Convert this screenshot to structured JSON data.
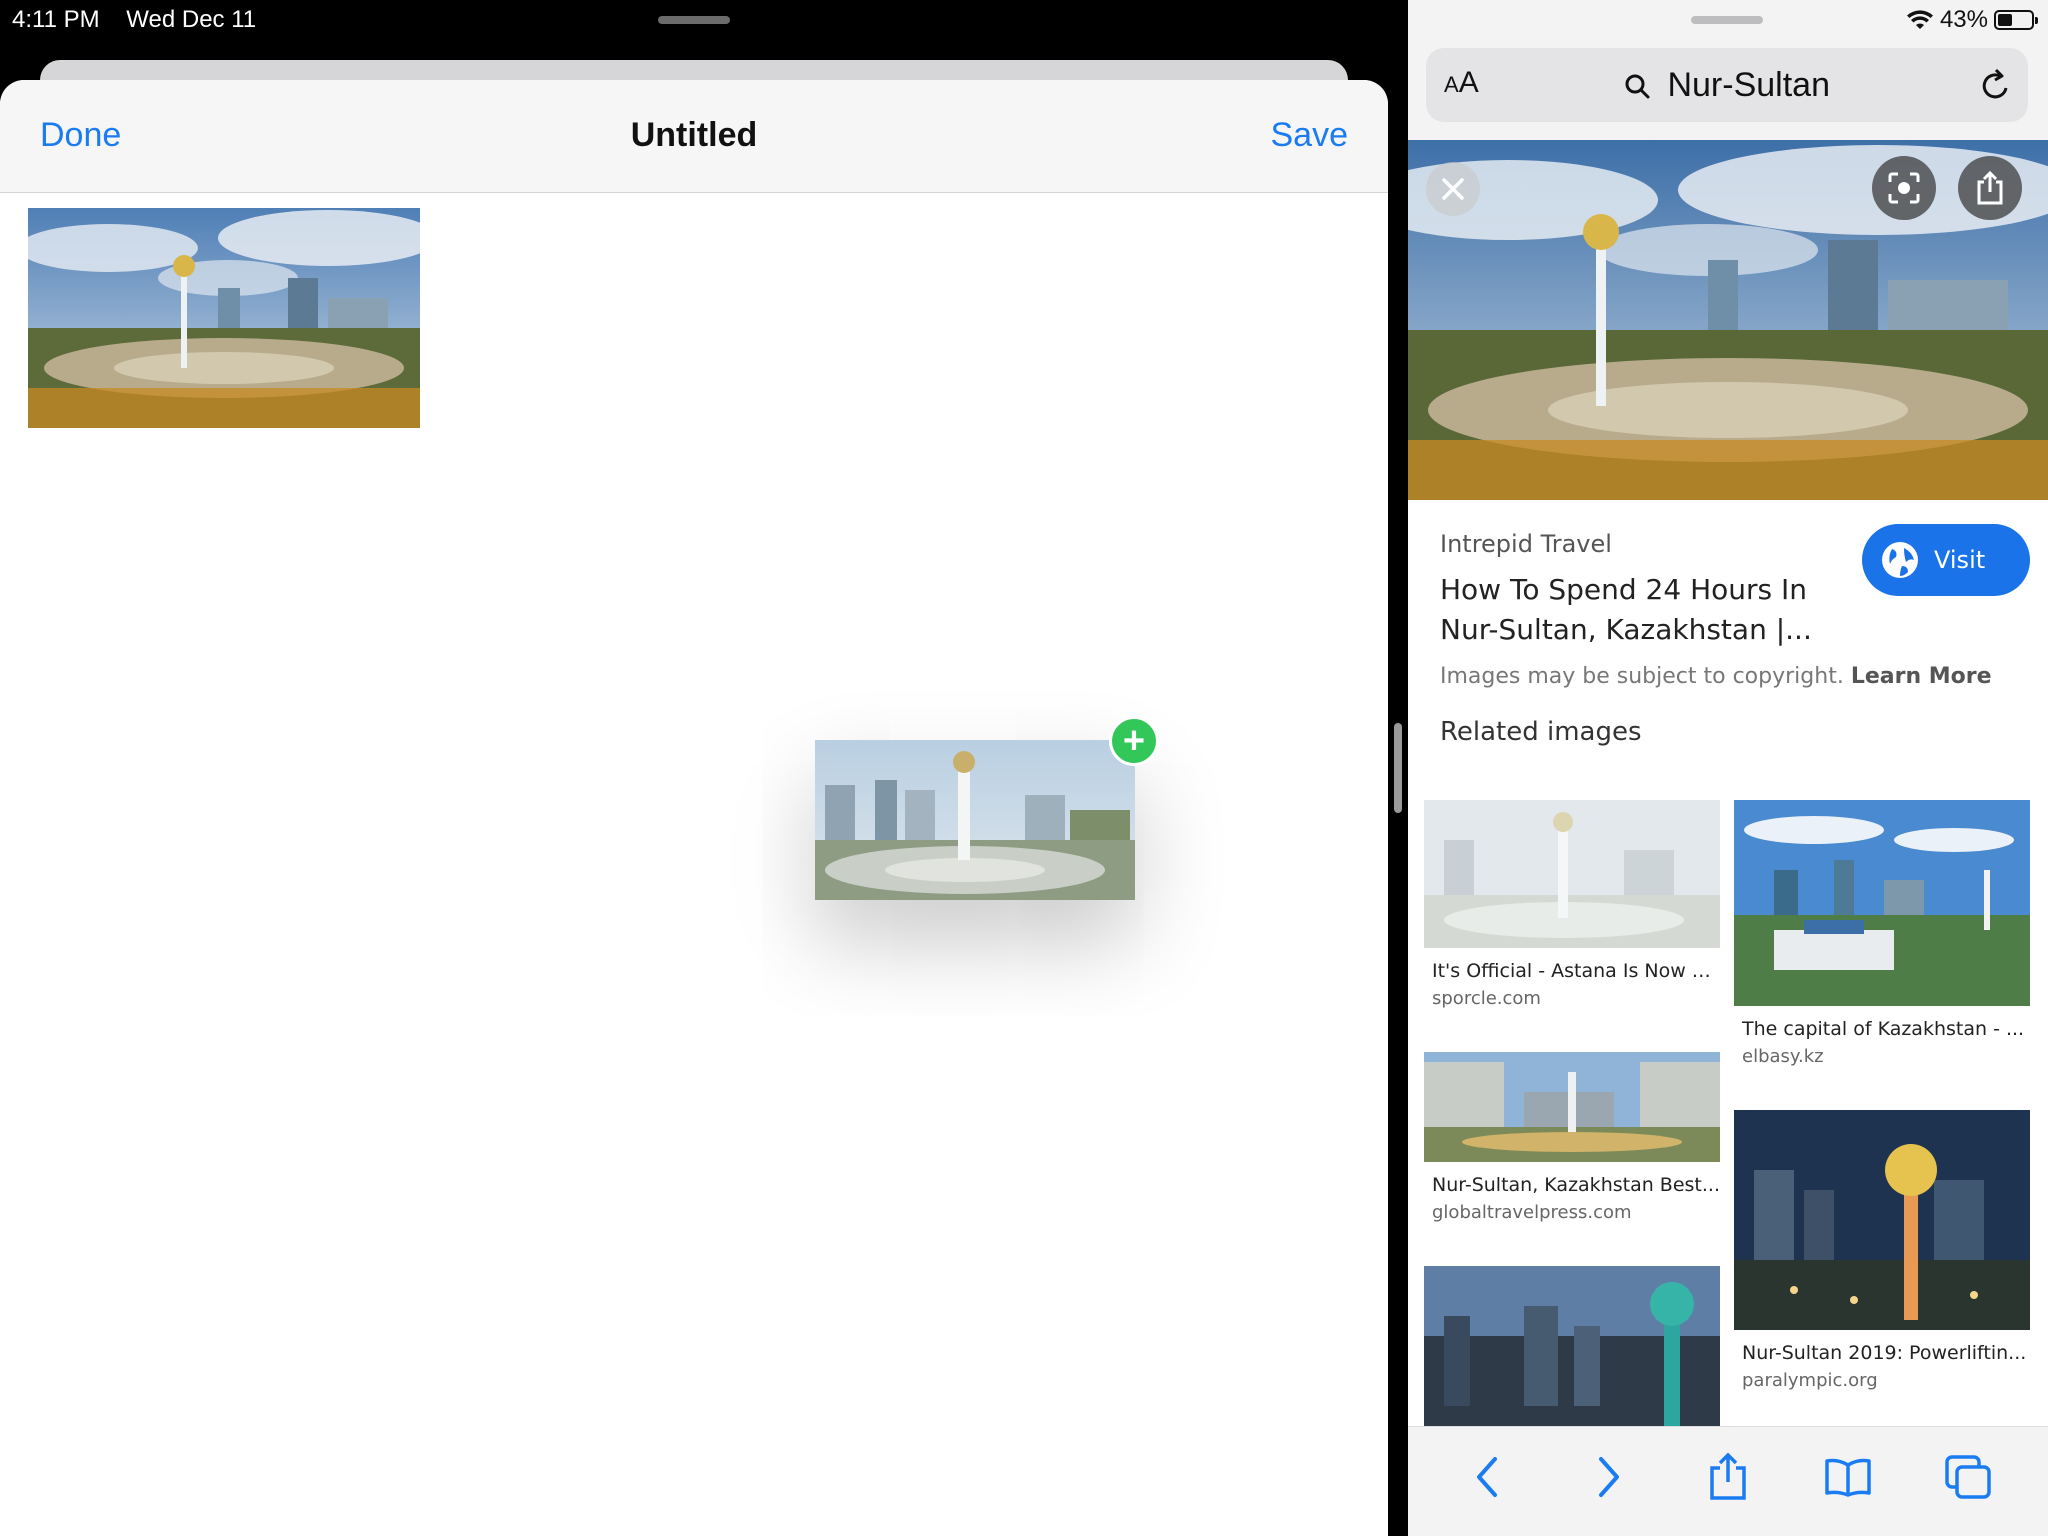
{
  "status": {
    "time": "4:11 PM",
    "date": "Wed Dec 11",
    "battery": "43%",
    "battery_level": 0.43
  },
  "notes": {
    "done_label": "Done",
    "title": "Untitled",
    "save_label": "Save",
    "drop_badge": "+"
  },
  "safari": {
    "aa_label": "AA",
    "url_text": "Nur-Sultan",
    "source": "Intrepid Travel",
    "headline": "How To Spend 24 Hours In Nur-Sultan, Kazakhstan |...",
    "visit_label": "Visit",
    "copyright_text": "Images may be subject to copyright.",
    "learn_more": "Learn More",
    "related_heading": "Related images",
    "related": [
      {
        "caption": "It's Official - Astana Is Now C...",
        "domain": "sporcle.com"
      },
      {
        "caption": "The capital of Kazakhstan - ...",
        "domain": "elbasy.kz"
      },
      {
        "caption": "Nur-Sultan, Kazakhstan Best...",
        "domain": "globaltravelpress.com"
      },
      {
        "caption": "Nur-Sultan 2019: Powerliftin...",
        "domain": "paralympic.org"
      }
    ]
  },
  "colors": {
    "accent": "#1a7cf0",
    "visit_blue": "#1a73e8",
    "add_green": "#33c759"
  }
}
